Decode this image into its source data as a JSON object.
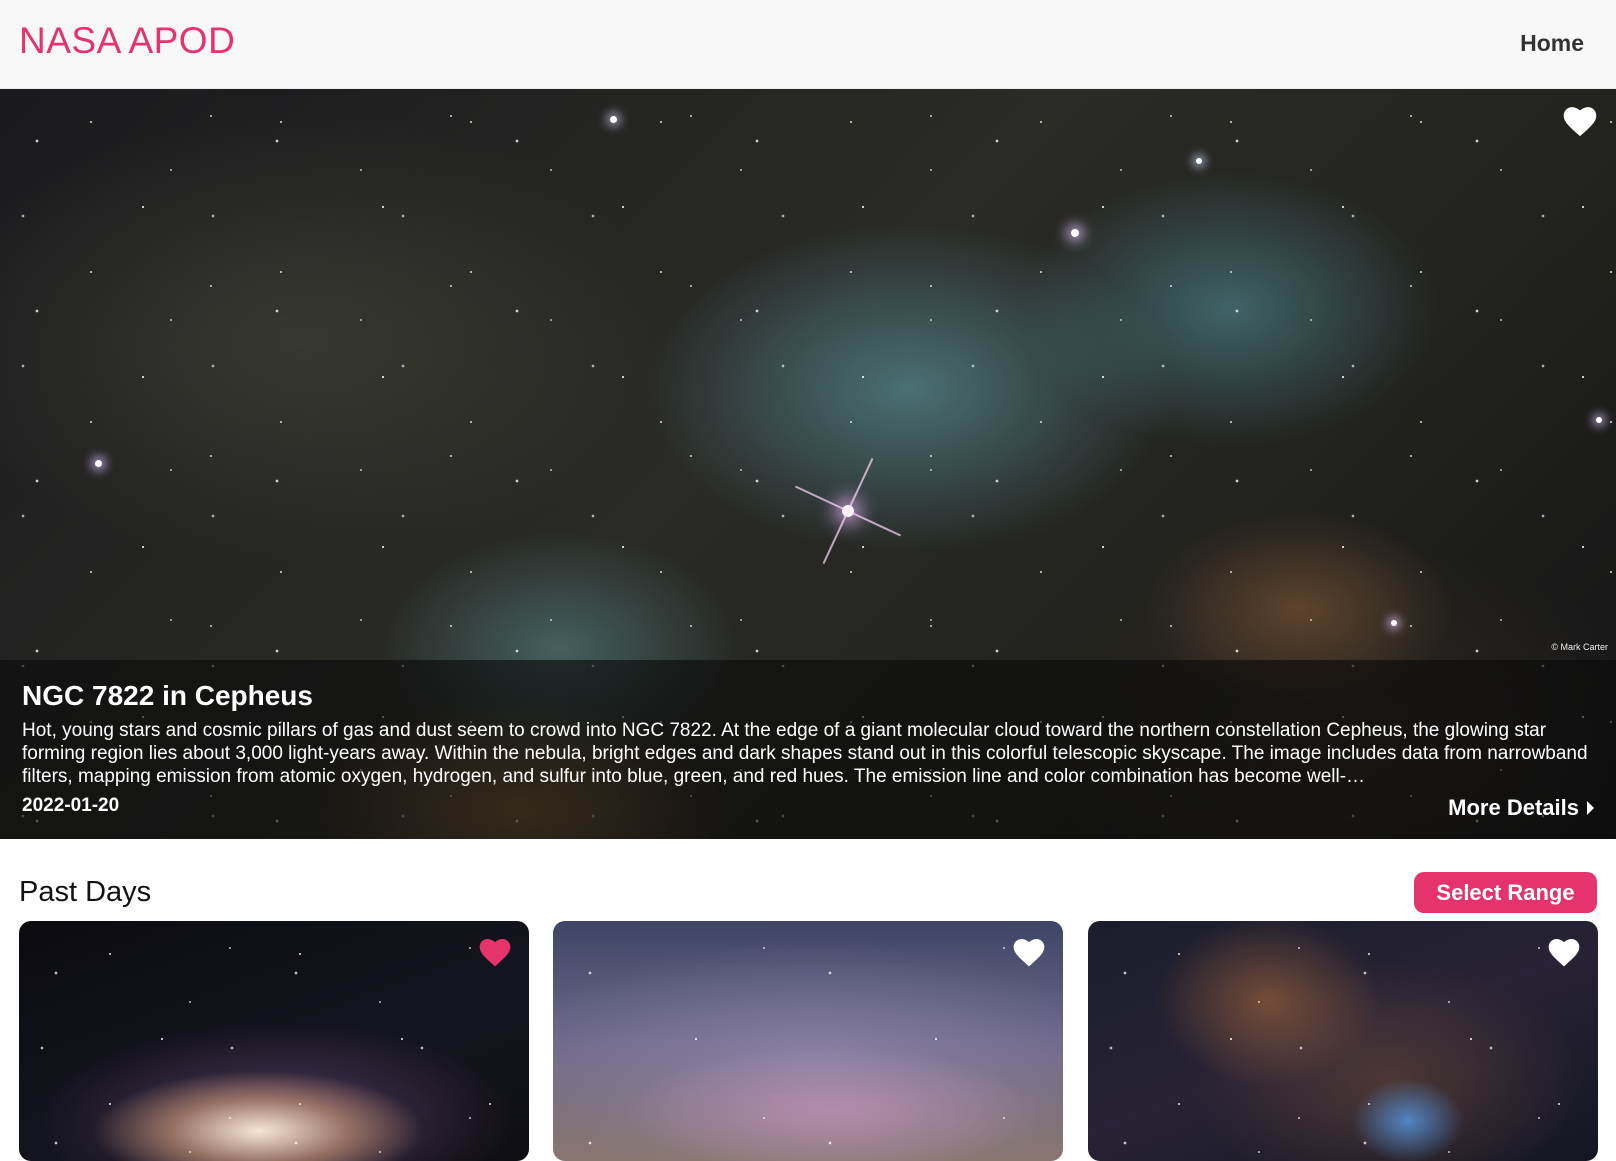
{
  "header": {
    "brand": "NASA APOD",
    "nav_home": "Home"
  },
  "hero": {
    "title": "NGC 7822 in Cepheus",
    "description": "Hot, young stars and cosmic pillars of gas and dust seem to crowd into NGC 7822. At the edge of a giant molecular cloud toward the northern constellation Cepheus, the glowing star forming region lies about 3,000 light-years away. Within the nebula, bright edges and dark shapes stand out in this colorful telescopic skyscape. The image includes data from narrowband filters, mapping emission from atomic oxygen, hydrogen, and sulfur into blue, green, and red hues. The emission line and color combination has become well-…",
    "date": "2022-01-20",
    "credit": "© Mark Carter",
    "more_details": "More Details",
    "favorited": false
  },
  "past_days": {
    "title": "Past Days",
    "select_range": "Select Range",
    "cards": [
      {
        "favorited": true,
        "heart_color": "#e5336b"
      },
      {
        "favorited": false,
        "heart_color": "#ffffff"
      },
      {
        "favorited": false,
        "heart_color": "#ffffff"
      }
    ]
  },
  "colors": {
    "accent": "#e5336b",
    "header_bg": "#f8f8f8"
  }
}
